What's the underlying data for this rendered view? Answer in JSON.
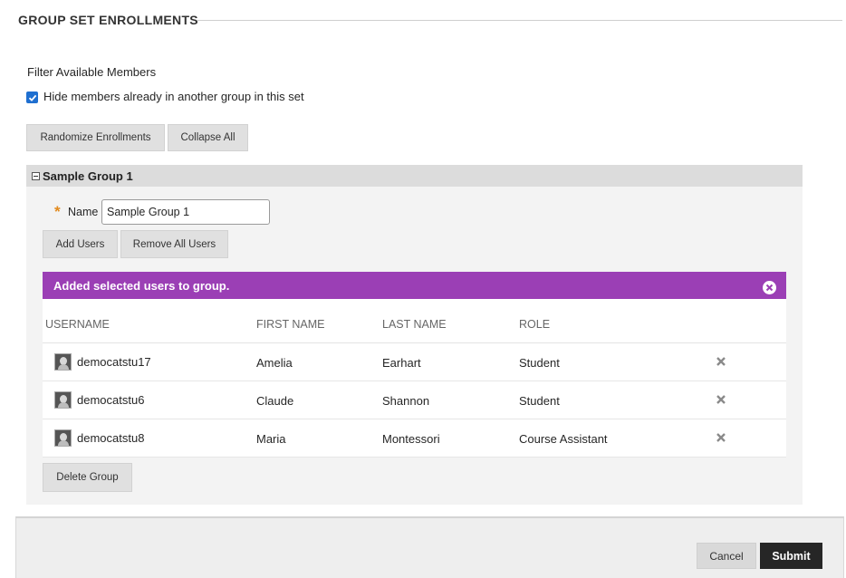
{
  "section": {
    "title": "GROUP SET ENROLLMENTS"
  },
  "filter": {
    "label": "Filter Available Members",
    "hide_checkbox_label": "Hide members already in another group in this set",
    "hide_checked": true
  },
  "toolbar": {
    "randomize_label": "Randomize Enrollments",
    "collapse_label": "Collapse All"
  },
  "group": {
    "title": "Sample Group 1",
    "expanded": true,
    "name_label": "Name",
    "name_value": "Sample Group 1",
    "required_marker": "*",
    "add_users_label": "Add Users",
    "remove_all_label": "Remove All Users",
    "banner_message": "Added selected users to group.",
    "banner_color": "#9b3fb5",
    "columns": [
      "USERNAME",
      "FIRST NAME",
      "LAST NAME",
      "ROLE"
    ],
    "members": [
      {
        "username": "democatstu17",
        "first_name": "Amelia",
        "last_name": "Earhart",
        "role": "Student",
        "avatar_icon": "user-avatar-icon",
        "remove_icon": "remove-x-icon"
      },
      {
        "username": "democatstu6",
        "first_name": "Claude",
        "last_name": "Shannon",
        "role": "Student",
        "avatar_icon": "user-avatar-icon",
        "remove_icon": "remove-x-icon"
      },
      {
        "username": "democatstu8",
        "first_name": "Maria",
        "last_name": "Montessori",
        "role": "Course Assistant",
        "avatar_icon": "user-avatar-icon",
        "remove_icon": "remove-x-icon"
      }
    ],
    "delete_label": "Delete Group"
  },
  "footer": {
    "cancel_label": "Cancel",
    "submit_label": "Submit"
  },
  "colors": {
    "accent_checkbox": "#1f6fd0",
    "required_star": "#e28a1d",
    "submit_bg": "#262626"
  }
}
